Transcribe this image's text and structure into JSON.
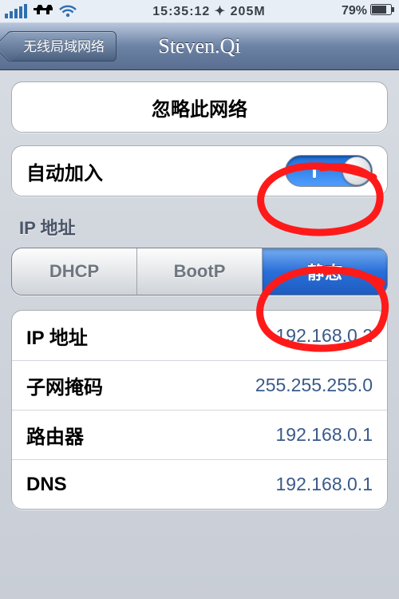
{
  "statusbar": {
    "time": "15:35:12",
    "extra": "205M",
    "battery_pct": "79%"
  },
  "navbar": {
    "back_label": "无线局域网络",
    "title": "Steven.Qi"
  },
  "forget_button": {
    "label": "忽略此网络"
  },
  "auto_join": {
    "label": "自动加入",
    "on": true
  },
  "section_ip": {
    "title": "IP 地址"
  },
  "segments": {
    "dhcp": "DHCP",
    "bootp": "BootP",
    "static_": "静态"
  },
  "fields": {
    "ip_label": "IP 地址",
    "ip_value": "192.168.0.2",
    "mask_label": "子网掩码",
    "mask_value": "255.255.255.0",
    "router_label": "路由器",
    "router_value": "192.168.0.1",
    "dns_label": "DNS",
    "dns_value": "192.168.0.1"
  },
  "annotation_color": "#ff1a1a"
}
